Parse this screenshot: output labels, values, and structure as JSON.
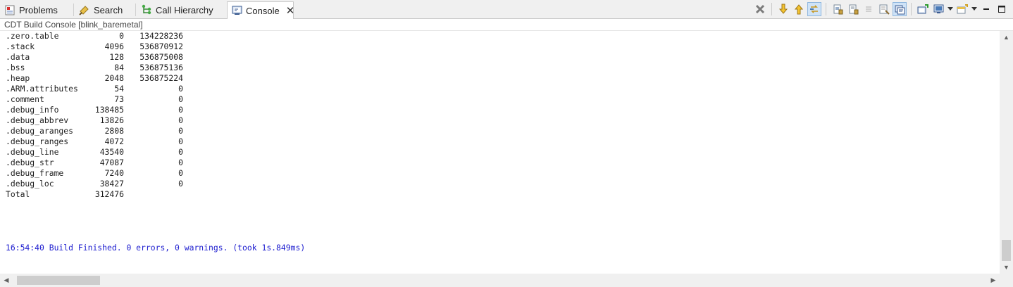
{
  "tabs": [
    {
      "label": "Problems",
      "icon": "problems-icon",
      "active": false
    },
    {
      "label": "Search",
      "icon": "search-icon",
      "active": false
    },
    {
      "label": "Call Hierarchy",
      "icon": "call-hierarchy-icon",
      "active": false
    },
    {
      "label": "Console",
      "icon": "console-icon",
      "active": true
    }
  ],
  "toolbar": {
    "buttons": [
      "remove-all-terminated-icon",
      "next-error-icon",
      "previous-error-icon",
      "link-with-editor-icon",
      "scroll-lock-icon",
      "word-wrap-icon",
      "clear-console-icon",
      "pin-console-icon",
      "copy-build-log-icon",
      "new-console-icon",
      "display-console-icon",
      "open-console-icon",
      "minimize-icon",
      "maximize-icon"
    ]
  },
  "console_label": "CDT Build Console [blink_baremetal]",
  "output_rows": [
    {
      "name": ".zero.table",
      "size": "0",
      "addr": "134228236"
    },
    {
      "name": ".stack",
      "size": "4096",
      "addr": "536870912"
    },
    {
      "name": ".data",
      "size": "128",
      "addr": "536875008"
    },
    {
      "name": ".bss",
      "size": "84",
      "addr": "536875136"
    },
    {
      "name": ".heap",
      "size": "2048",
      "addr": "536875224"
    },
    {
      "name": ".ARM.attributes",
      "size": "54",
      "addr": "0"
    },
    {
      "name": ".comment",
      "size": "73",
      "addr": "0"
    },
    {
      "name": ".debug_info",
      "size": "138485",
      "addr": "0"
    },
    {
      "name": ".debug_abbrev",
      "size": "13826",
      "addr": "0"
    },
    {
      "name": ".debug_aranges",
      "size": "2808",
      "addr": "0"
    },
    {
      "name": ".debug_ranges",
      "size": "4072",
      "addr": "0"
    },
    {
      "name": ".debug_line",
      "size": "43540",
      "addr": "0"
    },
    {
      "name": ".debug_str",
      "size": "47087",
      "addr": "0"
    },
    {
      "name": ".debug_frame",
      "size": "7240",
      "addr": "0"
    },
    {
      "name": ".debug_loc",
      "size": "38427",
      "addr": "0"
    },
    {
      "name": "Total",
      "size": "312476",
      "addr": ""
    }
  ],
  "status_line": "16:54:40 Build Finished. 0 errors, 0 warnings. (took 1s.849ms)",
  "colors": {
    "status_text": "#1c1ccf",
    "output_text": "#1e1e1e",
    "tab_bar": "#f0f0f0"
  }
}
